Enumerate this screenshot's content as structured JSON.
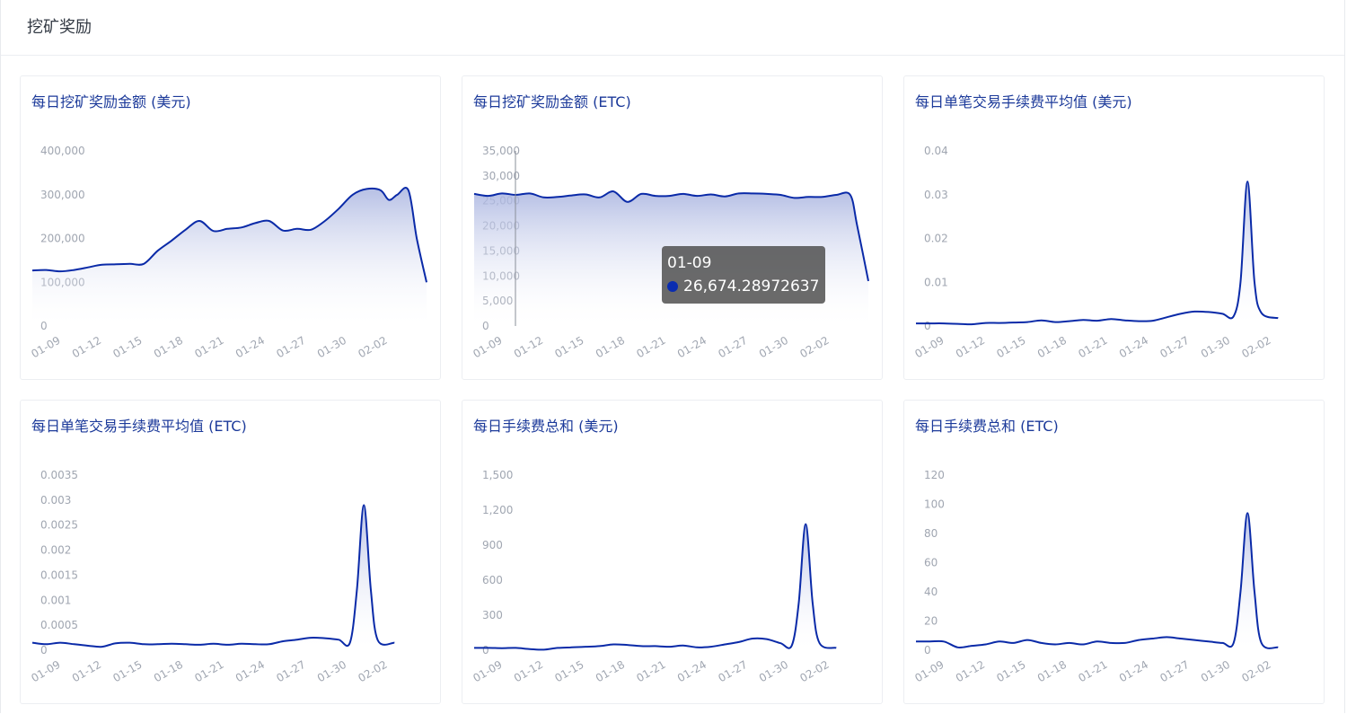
{
  "page_title": "挖矿奖励",
  "chart_data": [
    {
      "type": "area",
      "title": "每日挖矿奖励金额 (美元)",
      "categories": [
        "01-09",
        "01-12",
        "01-15",
        "01-18",
        "01-21",
        "01-24",
        "01-27",
        "01-30",
        "02-02"
      ],
      "y_ticks": [
        "0",
        "100,000",
        "200,000",
        "300,000",
        "400,000"
      ],
      "ylim": [
        0,
        400000
      ],
      "xrange": [
        0,
        27
      ],
      "series": [
        {
          "values": [
            [
              0,
              127000
            ],
            [
              1,
              128000
            ],
            [
              2,
              125000
            ],
            [
              3,
              128000
            ],
            [
              4,
              134000
            ],
            [
              5,
              140000
            ],
            [
              6,
              141000
            ],
            [
              7,
              142000
            ],
            [
              8,
              142000
            ],
            [
              9,
              172000
            ],
            [
              10,
              195000
            ],
            [
              11,
              220000
            ],
            [
              12,
              240000
            ],
            [
              13,
              217000
            ],
            [
              14,
              222000
            ],
            [
              15,
              225000
            ],
            [
              16,
              235000
            ],
            [
              17,
              240000
            ],
            [
              18,
              218000
            ],
            [
              19,
              222000
            ],
            [
              20,
              220000
            ],
            [
              21,
              240000
            ],
            [
              22,
              268000
            ],
            [
              23,
              300000
            ],
            [
              24,
              313000
            ],
            [
              25,
              310000
            ],
            [
              25.6,
              288000
            ],
            [
              26.2,
              300000
            ],
            [
              27,
              310000
            ],
            [
              27.6,
              200000
            ],
            [
              28.3,
              100000
            ]
          ]
        }
      ],
      "tooltip": null
    },
    {
      "type": "area",
      "title": "每日挖矿奖励金额 (ETC)",
      "categories": [
        "01-09",
        "01-12",
        "01-15",
        "01-18",
        "01-21",
        "01-24",
        "01-27",
        "01-30",
        "02-02"
      ],
      "y_ticks": [
        "0",
        "5,000",
        "10,000",
        "15,000",
        "20,000",
        "25,000",
        "30,000",
        "35,000"
      ],
      "ylim": [
        0,
        35000
      ],
      "xrange": [
        0,
        27
      ],
      "series": [
        {
          "values": [
            [
              0,
              26400
            ],
            [
              1,
              26000
            ],
            [
              2,
              26500
            ],
            [
              3,
              26200
            ],
            [
              4,
              26500
            ],
            [
              5,
              25700
            ],
            [
              6,
              25800
            ],
            [
              7,
              26100
            ],
            [
              8,
              26300
            ],
            [
              9,
              25700
            ],
            [
              10,
              26900
            ],
            [
              11,
              24800
            ],
            [
              12,
              26400
            ],
            [
              13,
              26000
            ],
            [
              14,
              26000
            ],
            [
              15,
              26400
            ],
            [
              16,
              26000
            ],
            [
              17,
              26300
            ],
            [
              18,
              25900
            ],
            [
              19,
              26500
            ],
            [
              20,
              26500
            ],
            [
              21,
              26400
            ],
            [
              22,
              26200
            ],
            [
              23,
              25600
            ],
            [
              24,
              25800
            ],
            [
              25,
              25800
            ],
            [
              26,
              26200
            ],
            [
              27,
              26200
            ],
            [
              27.5,
              20000
            ],
            [
              28.3,
              9000
            ]
          ]
        }
      ],
      "tooltip": {
        "label": "01-09",
        "value": "26,674.28972637",
        "x_index": 0.15
      }
    },
    {
      "type": "area",
      "title": "每日单笔交易手续费平均值 (美元)",
      "categories": [
        "01-09",
        "01-12",
        "01-15",
        "01-18",
        "01-21",
        "01-24",
        "01-27",
        "01-30",
        "02-02"
      ],
      "y_ticks": [
        "0",
        "0.01",
        "0.02",
        "0.03",
        "0.04"
      ],
      "ylim": [
        0,
        0.04
      ],
      "xrange": [
        0,
        27
      ],
      "series": [
        {
          "values": [
            [
              0,
              0.0006
            ],
            [
              1,
              0.0006
            ],
            [
              2,
              0.0006
            ],
            [
              3,
              0.0005
            ],
            [
              4,
              0.0004
            ],
            [
              5,
              0.0007
            ],
            [
              6,
              0.0007
            ],
            [
              7,
              0.0008
            ],
            [
              8,
              0.0009
            ],
            [
              9,
              0.0013
            ],
            [
              10,
              0.0009
            ],
            [
              11,
              0.0011
            ],
            [
              12,
              0.0014
            ],
            [
              13,
              0.0012
            ],
            [
              14,
              0.0016
            ],
            [
              15,
              0.0013
            ],
            [
              16,
              0.0011
            ],
            [
              17,
              0.0012
            ],
            [
              18,
              0.002
            ],
            [
              19,
              0.0028
            ],
            [
              20,
              0.0033
            ],
            [
              21,
              0.0032
            ],
            [
              22,
              0.0028
            ],
            [
              22.8,
              0.0022
            ],
            [
              23.3,
              0.01
            ],
            [
              23.8,
              0.033
            ],
            [
              24.3,
              0.01
            ],
            [
              24.8,
              0.003
            ],
            [
              26,
              0.0018
            ]
          ]
        }
      ],
      "tooltip": null
    },
    {
      "type": "area",
      "title": "每日单笔交易手续费平均值 (ETC)",
      "categories": [
        "01-09",
        "01-12",
        "01-15",
        "01-18",
        "01-21",
        "01-24",
        "01-27",
        "01-30",
        "02-02"
      ],
      "y_ticks": [
        "0",
        "0.0005",
        "0.001",
        "0.0015",
        "0.002",
        "0.0025",
        "0.003",
        "0.0035"
      ],
      "ylim": [
        0,
        0.0035
      ],
      "xrange": [
        0,
        27
      ],
      "series": [
        {
          "values": [
            [
              0,
              0.00015
            ],
            [
              1,
              0.00012
            ],
            [
              2,
              0.00015
            ],
            [
              3,
              0.00012
            ],
            [
              4,
              9e-05
            ],
            [
              5,
              7e-05
            ],
            [
              6,
              0.00014
            ],
            [
              7,
              0.00015
            ],
            [
              8,
              0.00012
            ],
            [
              9,
              0.00012
            ],
            [
              10,
              0.00013
            ],
            [
              11,
              0.00012
            ],
            [
              12,
              0.00011
            ],
            [
              13,
              0.00013
            ],
            [
              14,
              0.00011
            ],
            [
              15,
              0.00013
            ],
            [
              16,
              0.00012
            ],
            [
              17,
              0.00012
            ],
            [
              18,
              0.00018
            ],
            [
              19,
              0.00021
            ],
            [
              20,
              0.00025
            ],
            [
              21,
              0.00024
            ],
            [
              22,
              0.00021
            ],
            [
              22.8,
              0.00015
            ],
            [
              23.3,
              0.0012
            ],
            [
              23.8,
              0.0029
            ],
            [
              24.3,
              0.0012
            ],
            [
              24.8,
              0.0002
            ],
            [
              26,
              0.00015
            ]
          ]
        }
      ],
      "tooltip": null
    },
    {
      "type": "area",
      "title": "每日手续费总和 (美元)",
      "categories": [
        "01-09",
        "01-12",
        "01-15",
        "01-18",
        "01-21",
        "01-24",
        "01-27",
        "01-30",
        "02-02"
      ],
      "y_ticks": [
        "0",
        "300",
        "600",
        "900",
        "1,200",
        "1,500"
      ],
      "ylim": [
        0,
        1500
      ],
      "xrange": [
        0,
        27
      ],
      "series": [
        {
          "values": [
            [
              0,
              20
            ],
            [
              1,
              20
            ],
            [
              2,
              18
            ],
            [
              3,
              20
            ],
            [
              4,
              10
            ],
            [
              5,
              5
            ],
            [
              6,
              20
            ],
            [
              7,
              25
            ],
            [
              8,
              30
            ],
            [
              9,
              35
            ],
            [
              10,
              50
            ],
            [
              11,
              45
            ],
            [
              12,
              35
            ],
            [
              13,
              35
            ],
            [
              14,
              30
            ],
            [
              15,
              40
            ],
            [
              16,
              25
            ],
            [
              17,
              30
            ],
            [
              18,
              50
            ],
            [
              19,
              70
            ],
            [
              20,
              100
            ],
            [
              21,
              95
            ],
            [
              22,
              60
            ],
            [
              22.8,
              40
            ],
            [
              23.3,
              400
            ],
            [
              23.8,
              1080
            ],
            [
              24.3,
              400
            ],
            [
              24.8,
              60
            ],
            [
              26,
              20
            ]
          ]
        }
      ],
      "tooltip": null
    },
    {
      "type": "area",
      "title": "每日手续费总和 (ETC)",
      "categories": [
        "01-09",
        "01-12",
        "01-15",
        "01-18",
        "01-21",
        "01-24",
        "01-27",
        "01-30",
        "02-02"
      ],
      "y_ticks": [
        "0",
        "20",
        "40",
        "60",
        "80",
        "100",
        "120"
      ],
      "ylim": [
        0,
        120
      ],
      "xrange": [
        0,
        27
      ],
      "series": [
        {
          "values": [
            [
              0,
              6
            ],
            [
              1,
              6
            ],
            [
              2,
              6
            ],
            [
              3,
              2
            ],
            [
              4,
              3
            ],
            [
              5,
              4
            ],
            [
              6,
              6
            ],
            [
              7,
              5
            ],
            [
              8,
              7
            ],
            [
              9,
              5
            ],
            [
              10,
              4
            ],
            [
              11,
              5
            ],
            [
              12,
              4
            ],
            [
              13,
              6
            ],
            [
              14,
              5
            ],
            [
              15,
              5
            ],
            [
              16,
              7
            ],
            [
              17,
              8
            ],
            [
              18,
              9
            ],
            [
              19,
              8
            ],
            [
              20,
              7
            ],
            [
              21,
              6
            ],
            [
              22,
              5
            ],
            [
              22.8,
              5
            ],
            [
              23.3,
              40
            ],
            [
              23.8,
              94
            ],
            [
              24.3,
              40
            ],
            [
              24.8,
              5
            ],
            [
              26,
              2
            ]
          ]
        }
      ],
      "tooltip": null
    }
  ]
}
